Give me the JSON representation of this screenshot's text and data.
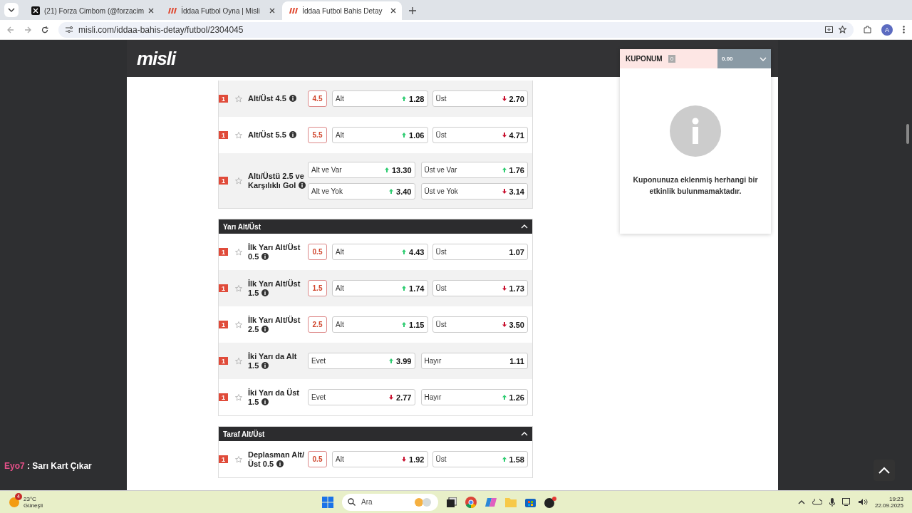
{
  "browser": {
    "tabs": [
      {
        "title": "(21) Forza Cimbom (@forzacim",
        "kind": "x",
        "selected": false
      },
      {
        "title": "İddaa Futbol Oyna | Misli",
        "kind": "misli",
        "selected": false
      },
      {
        "title": "İddaa Futbol Bahis Detay",
        "kind": "misli",
        "selected": true
      }
    ],
    "url": "misli.com/iddaa-bahis-detay/futbol/2304045",
    "profile": "A"
  },
  "site": {
    "logo": "misli"
  },
  "chat": {
    "user": "Eyo7",
    "message": " : Sarı Kart Çıkar"
  },
  "sections": [
    {
      "markets": [
        {
          "kind": "line",
          "badge": "1",
          "name": "Alt/Üst 4.5",
          "line": "4.5",
          "outcomes": [
            {
              "label": "Alt",
              "odd": "1.28",
              "kind": "up"
            },
            {
              "label": "Üst",
              "odd": "2.70",
              "kind": "down"
            }
          ]
        },
        {
          "kind": "line",
          "badge": "1",
          "name": "Alt/Üst 5.5",
          "line": "5.5",
          "outcomes": [
            {
              "label": "Alt",
              "odd": "1.06",
              "kind": "up"
            },
            {
              "label": "Üst",
              "odd": "4.71",
              "kind": "down"
            }
          ]
        },
        {
          "kind": "plain",
          "badge": "1",
          "name": "Altı/Üstü 2.5 ve Karşılıklı Gol",
          "outcomes": [
            {
              "label": "Alt ve Var",
              "odd": "13.30",
              "kind": "up"
            },
            {
              "label": "Üst ve Var",
              "odd": "1.76",
              "kind": "up"
            },
            {
              "label": "Alt ve Yok",
              "odd": "3.40",
              "kind": "up"
            },
            {
              "label": "Üst ve Yok",
              "odd": "3.14",
              "kind": "down"
            }
          ]
        }
      ]
    },
    {
      "title": "Yarı Alt/Üst",
      "expanded": true,
      "markets": [
        {
          "kind": "line",
          "badge": "1",
          "name": "İlk Yarı Alt/Üst 0.5",
          "line": "0.5",
          "outcomes": [
            {
              "label": "Alt",
              "odd": "4.43",
              "kind": "up"
            },
            {
              "label": "Üst",
              "odd": "1.07",
              "kind": "none"
            }
          ]
        },
        {
          "kind": "line",
          "badge": "1",
          "name": "İlk Yarı Alt/Üst 1.5",
          "line": "1.5",
          "outcomes": [
            {
              "label": "Alt",
              "odd": "1.74",
              "kind": "up"
            },
            {
              "label": "Üst",
              "odd": "1.73",
              "kind": "down"
            }
          ]
        },
        {
          "kind": "line",
          "badge": "1",
          "name": "İlk Yarı Alt/Üst 2.5",
          "line": "2.5",
          "outcomes": [
            {
              "label": "Alt",
              "odd": "1.15",
              "kind": "up"
            },
            {
              "label": "Üst",
              "odd": "3.50",
              "kind": "down"
            }
          ]
        },
        {
          "kind": "plain",
          "badge": "1",
          "name": "İki Yarı da Alt 1.5",
          "outcomes": [
            {
              "label": "Evet",
              "odd": "3.99",
              "kind": "up"
            },
            {
              "label": "Hayır",
              "odd": "1.11",
              "kind": "none"
            }
          ]
        },
        {
          "kind": "plain",
          "badge": "1",
          "name": "İki Yarı da Üst 1.5",
          "outcomes": [
            {
              "label": "Evet",
              "odd": "2.77",
              "kind": "down"
            },
            {
              "label": "Hayır",
              "odd": "1.26",
              "kind": "up"
            }
          ]
        }
      ]
    },
    {
      "title": "Taraf Alt/Üst",
      "expanded": true,
      "markets": [
        {
          "kind": "line",
          "badge": "1",
          "name": "Deplasman Alt/ Üst 0.5",
          "line": "0.5",
          "outcomes": [
            {
              "label": "Alt",
              "odd": "1.92",
              "kind": "down"
            },
            {
              "label": "Üst",
              "odd": "1.58",
              "kind": "up"
            }
          ]
        }
      ]
    }
  ],
  "coupon": {
    "title": "KUPONUM",
    "count": "0",
    "total": "0.00",
    "empty_message": "Kuponunuza eklenmiş herhangi bir etkinlik bulunmamaktadır."
  },
  "taskbar": {
    "weather": {
      "temp": "23°C",
      "condition": "Güneşli",
      "badge": "4"
    },
    "search_placeholder": "Ara",
    "time": "19:23",
    "date": "22.09.2025"
  }
}
